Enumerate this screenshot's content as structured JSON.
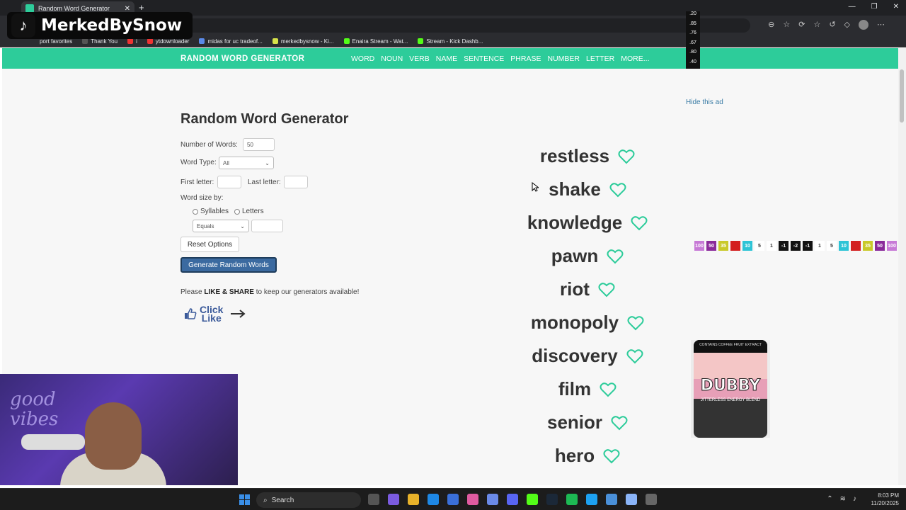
{
  "browser": {
    "tab_title": "Random Word Generator",
    "new_tab": "+",
    "bookmarks": [
      "port favorites",
      "Thank You",
      "i",
      "ytdownloader",
      "midas for uc tradeof...",
      "merkedbysnow - Ki...",
      "Enaira Stream - Wat...",
      "Stream - Kick Dashb..."
    ]
  },
  "site": {
    "brand": "RANDOM WORD GENERATOR",
    "nav": [
      "WORD",
      "NOUN",
      "VERB",
      "NAME",
      "SENTENCE",
      "PHRASE",
      "NUMBER",
      "LETTER",
      "MORE..."
    ],
    "accent_color": "#2dcc9a"
  },
  "form": {
    "title": "Random Word Generator",
    "num_words_label": "Number of Words:",
    "num_words_value": "50",
    "word_type_label": "Word Type:",
    "word_type_value": "All",
    "first_letter_label": "First letter:",
    "last_letter_label": "Last letter:",
    "word_size_label": "Word size by:",
    "syllables_label": "Syllables",
    "letters_label": "Letters",
    "comparison_value": "Equals",
    "reset_label": "Reset Options",
    "generate_label": "Generate Random Words",
    "share_prefix": "Please ",
    "share_bold": "LIKE & SHARE",
    "share_suffix": " to keep our generators available!",
    "click_like_line1": "Click",
    "click_like_line2": "Like"
  },
  "words": [
    "restless",
    "shake",
    "knowledge",
    "pawn",
    "riot",
    "monopoly",
    "discovery",
    "film",
    "senior",
    "hero"
  ],
  "ad": {
    "hide_label": "Hide this ad",
    "product_name": "DUBBY",
    "product_tag": "CONTAINS COFFEE FRUIT EXTRACT",
    "product_sub": "JITTERLESS ENERGY BLEND"
  },
  "stream": {
    "channel_name": "MerkedBySnow",
    "side_numbers": [
      ".20",
      ".85",
      ".76",
      ".67",
      ".80",
      ".40"
    ],
    "row_numbers": [
      "100",
      "50",
      "35",
      "",
      "10",
      "5",
      "1",
      "-1",
      "-2",
      "-1",
      "1",
      "5",
      "10",
      "",
      "35",
      "50",
      "100"
    ]
  },
  "taskbar": {
    "search_label": "Search",
    "time": "8:03 PM",
    "date": "11/20/2025"
  }
}
